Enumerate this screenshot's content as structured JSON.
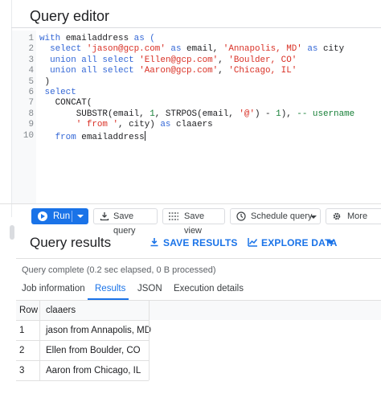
{
  "editor": {
    "title": "Query editor",
    "lines": [
      {
        "n": "1",
        "segs": [
          {
            "c": "kw",
            "t": "with "
          },
          {
            "c": "pl",
            "t": "emailaddress "
          },
          {
            "c": "kw",
            "t": "as ("
          }
        ]
      },
      {
        "n": "2",
        "segs": [
          {
            "c": "kw",
            "t": "  select "
          },
          {
            "c": "str",
            "t": "'jason@gcp.com'"
          },
          {
            "c": "kw",
            "t": " as "
          },
          {
            "c": "pl",
            "t": "email, "
          },
          {
            "c": "str",
            "t": "'Annapolis, MD'"
          },
          {
            "c": "kw",
            "t": " as "
          },
          {
            "c": "pl",
            "t": "city"
          }
        ]
      },
      {
        "n": "3",
        "segs": [
          {
            "c": "kw",
            "t": "  union all select "
          },
          {
            "c": "str",
            "t": "'Ellen@gcp.com'"
          },
          {
            "c": "pl",
            "t": ", "
          },
          {
            "c": "str",
            "t": "'Boulder, CO'"
          }
        ]
      },
      {
        "n": "4",
        "segs": [
          {
            "c": "kw",
            "t": "  union all select "
          },
          {
            "c": "str",
            "t": "'Aaron@gcp.com'"
          },
          {
            "c": "pl",
            "t": ", "
          },
          {
            "c": "str",
            "t": "'Chicago, IL'"
          }
        ]
      },
      {
        "n": "5",
        "segs": [
          {
            "c": "pl",
            "t": " )"
          }
        ]
      },
      {
        "n": "6",
        "segs": [
          {
            "c": "kw",
            "t": " select"
          }
        ]
      },
      {
        "n": "7",
        "segs": [
          {
            "c": "pl",
            "t": "   CONCAT("
          }
        ]
      },
      {
        "n": "8",
        "segs": [
          {
            "c": "pl",
            "t": "       SUBSTR(email, "
          },
          {
            "c": "num",
            "t": "1"
          },
          {
            "c": "pl",
            "t": ", STRPOS(email, "
          },
          {
            "c": "str",
            "t": "'@'"
          },
          {
            "c": "pl",
            "t": ") - "
          },
          {
            "c": "num",
            "t": "1"
          },
          {
            "c": "pl",
            "t": "), "
          },
          {
            "c": "cmt",
            "t": "-- username"
          }
        ]
      },
      {
        "n": "9",
        "segs": [
          {
            "c": "str",
            "t": "       ' from '"
          },
          {
            "c": "pl",
            "t": ", city) "
          },
          {
            "c": "kw",
            "t": "as "
          },
          {
            "c": "pl",
            "t": "claaers"
          }
        ]
      },
      {
        "n": "10",
        "segs": [
          {
            "c": "kw",
            "t": "   from "
          },
          {
            "c": "pl",
            "t": "emailaddress"
          }
        ],
        "cursor": true
      }
    ]
  },
  "toolbar": {
    "run_label": "Run",
    "save_query_label": "Save query",
    "save_view_label": "Save view",
    "schedule_label": "Schedule query",
    "more_label": "More"
  },
  "results": {
    "title": "Query results",
    "save_results_label": "SAVE RESULTS",
    "explore_label": "EXPLORE DATA",
    "status": "Query complete (0.2 sec elapsed, 0 B processed)",
    "tabs": [
      "Job information",
      "Results",
      "JSON",
      "Execution details"
    ],
    "active_tab": "Results",
    "columns": [
      "Row",
      "claaers"
    ],
    "rows": [
      [
        "1",
        "jason from Annapolis, MD"
      ],
      [
        "2",
        "Ellen from Boulder, CO"
      ],
      [
        "3",
        "Aaron from Chicago, IL"
      ]
    ]
  },
  "colors": {
    "accent": "#1a73e8",
    "keyword": "#3367d6",
    "string": "#d93025",
    "number": "#188038"
  },
  "icons": {
    "run": "play-circle-icon",
    "save_query": "save-icon",
    "save_view": "view-icon",
    "schedule": "clock-icon",
    "more": "gear-icon",
    "save_results": "download-icon",
    "explore": "chart-icon"
  }
}
